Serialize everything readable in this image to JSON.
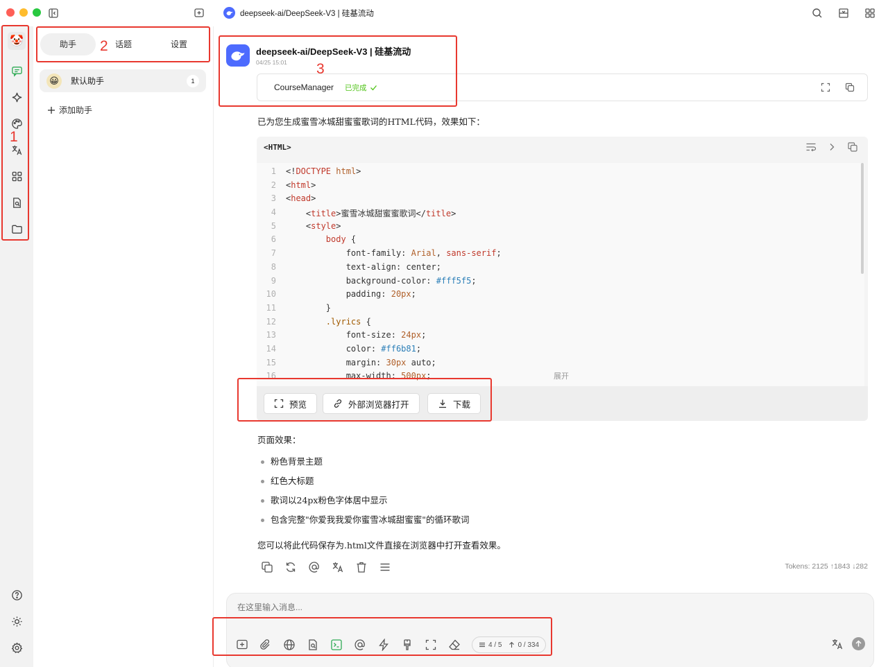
{
  "window": {
    "title": "deepseek-ai/DeepSeek-V3 | 硅基流动"
  },
  "panel": {
    "tabs": [
      "助手",
      "话题",
      "设置"
    ],
    "assistant": {
      "name": "默认助手",
      "count": "1"
    },
    "add_label": "添加助手"
  },
  "message": {
    "model": "deepseek-ai/DeepSeek-V3 | 硅基流动",
    "time": "04/25 15:01",
    "artifact_name": "CourseManager",
    "artifact_status": "已完成",
    "intro": "已为您生成蜜雪冰城甜蜜蜜歌词的HTML代码，效果如下：",
    "code_lang": "<HTML>",
    "code_lines": [
      "<!DOCTYPE html>",
      "<html>",
      "<head>",
      "    <title>蜜雪冰城甜蜜蜜歌词</title>",
      "    <style>",
      "        body {",
      "            font-family: Arial, sans-serif;",
      "            text-align: center;",
      "            background-color: #fff5f5;",
      "            padding: 20px;",
      "        }",
      "        .lyrics {",
      "            font-size: 24px;",
      "            color: #ff6b81;",
      "            margin: 30px auto;",
      "            max-width: 500px;"
    ],
    "expand_label": "展开",
    "buttons": {
      "preview": "预览",
      "open_external": "外部浏览器打开",
      "download": "下载"
    },
    "effect_title": "页面效果：",
    "bullets": [
      "粉色背景主题",
      "红色大标题",
      "歌词以24px粉色字体居中显示",
      "包含完整\"你爱我我爱你蜜雪冰城甜蜜蜜\"的循环歌词"
    ],
    "closing": "您可以将此代码保存为.html文件直接在浏览器中打开查看效果。",
    "tokens": "Tokens: 2125 ↑1843 ↓282"
  },
  "input": {
    "placeholder": "在这里输入消息...",
    "context_count": "4 / 5",
    "token_count": "0 / 334"
  },
  "annotations": [
    "1",
    "2",
    "3"
  ],
  "colors": {
    "accent": "#4d6bfe",
    "success": "#52c41a",
    "annotation": "#e8382f"
  }
}
